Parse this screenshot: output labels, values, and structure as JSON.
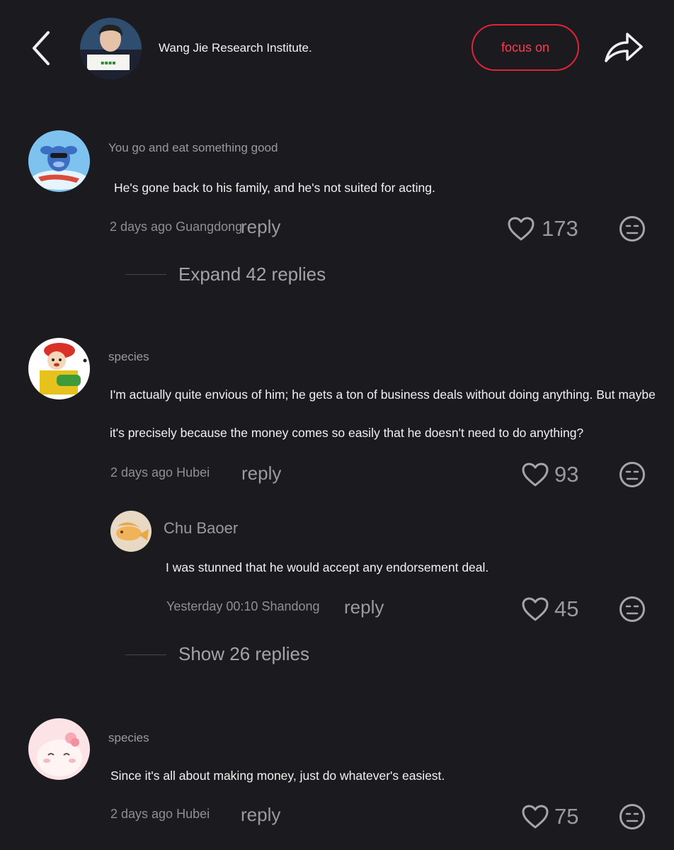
{
  "header": {
    "title": "Wang Jie Research Institute.",
    "follow_label": "focus on",
    "accent_color": "#e0233a"
  },
  "comments": [
    {
      "username": "You go and eat something good",
      "text_lines": [
        "He's gone back to his family, and he's not suited for acting."
      ],
      "meta": "2 days ago Guangdong",
      "reply_label": "reply",
      "likes": "173",
      "expand_label": "Expand 42 replies"
    },
    {
      "username": "species",
      "text_lines": [
        "I'm actually quite envious of him; he gets a ton of business deals without doing anything. But maybe",
        "it's precisely because the money comes so easily that he doesn't need to do anything?"
      ],
      "meta": "2 days ago Hubei",
      "reply_label": "reply",
      "likes": "93",
      "sub_reply": {
        "username": "Chu Baoer",
        "text": "I was stunned that he would accept any endorsement deal.",
        "meta": "Yesterday 00:10 Shandong",
        "reply_label": "reply",
        "likes": "45"
      },
      "expand_label": "Show 26 replies"
    },
    {
      "username": "species",
      "text_lines": [
        "Since it's all about making money, just do whatever's easiest."
      ],
      "meta": "2 days ago Hubei",
      "reply_label": "reply",
      "likes": "75"
    }
  ],
  "icons": {
    "back": "chevron-left-icon",
    "share": "share-arrow-icon",
    "like": "heart-outline-icon",
    "dislike": "meh-face-icon"
  }
}
